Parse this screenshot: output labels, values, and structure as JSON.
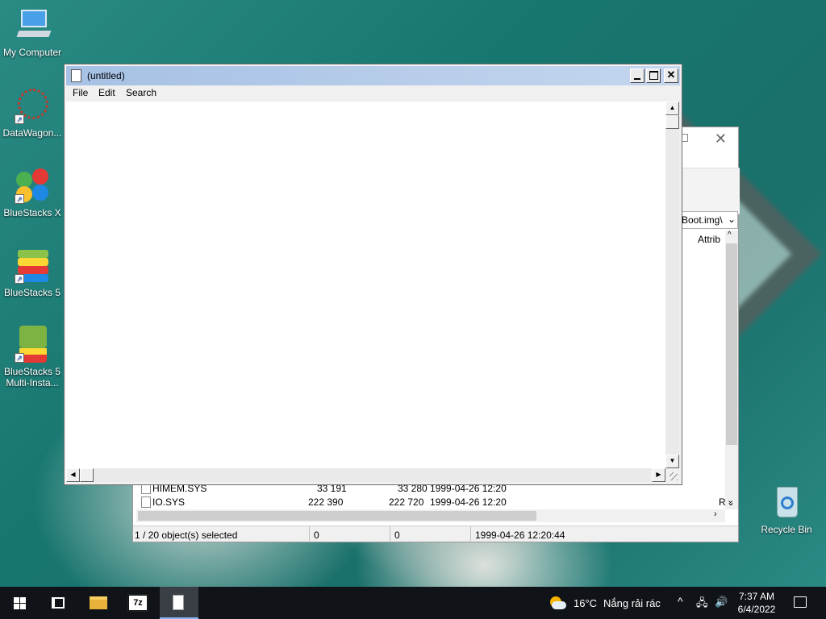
{
  "desktop": {
    "icons": [
      {
        "label": "My Computer",
        "icon": "computer-icon"
      },
      {
        "label": "DataWagon...",
        "icon": "datawagon-icon"
      },
      {
        "label": "BlueStacks X",
        "icon": "bluestacks-x-icon"
      },
      {
        "label": "BlueStacks 5",
        "icon": "bluestacks-5-icon"
      },
      {
        "label": "BlueStacks 5 Multi-Insta...",
        "icon": "bluestacks-multi-icon"
      },
      {
        "label": "Recycle Bin",
        "icon": "recycle-bin-icon"
      }
    ]
  },
  "explorer": {
    "address_fragment": "Boot.img\\",
    "column_header": "Attrib",
    "rows": [
      {
        "name": "HIMEM.SYS",
        "size": "33 191",
        "packed": "33 280",
        "modified": "1999-04-26 12:20",
        "attrib": ""
      },
      {
        "name": "IO.SYS",
        "size": "222 390",
        "packed": "222 720",
        "modified": "1999-04-26 12:20",
        "attrib": "R"
      }
    ],
    "status": {
      "selection": "1 / 20 object(s) selected",
      "size": "0",
      "packed": "0",
      "modified": "1999-04-26 12:20:44"
    }
  },
  "editor": {
    "title": "(untitled)",
    "menu": [
      "File",
      "Edit",
      "Search"
    ],
    "content": ""
  },
  "taskbar": {
    "sevenzip_label": "7z",
    "weather_temp": "16°C",
    "weather_desc": "Nắng rải rác",
    "time": "7:37 AM",
    "date": "6/4/2022",
    "accent": "#8ab4f8"
  }
}
